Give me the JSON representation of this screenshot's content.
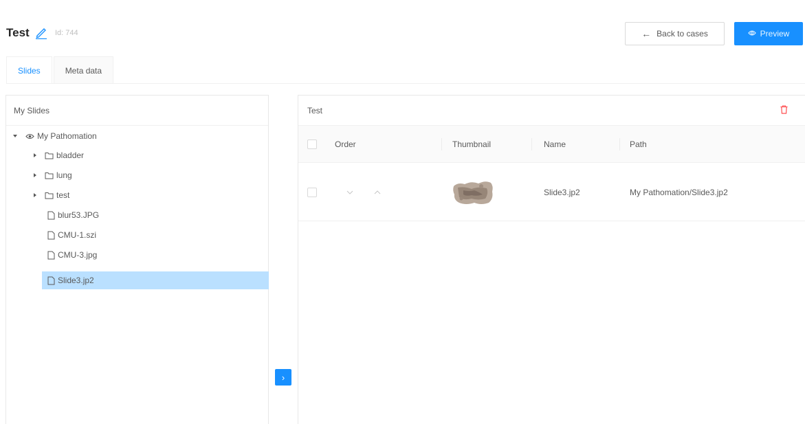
{
  "header": {
    "title": "Test",
    "id_label": "Id: 744",
    "back_button": "Back to cases",
    "preview_button": "Preview"
  },
  "tabs": [
    {
      "label": "Slides",
      "active": true
    },
    {
      "label": "Meta data",
      "active": false
    }
  ],
  "left_panel": {
    "title": "My Slides",
    "tree": [
      {
        "label": "My Pathomation",
        "type": "root",
        "expanded": true
      },
      {
        "label": "bladder",
        "type": "folder",
        "expanded": false
      },
      {
        "label": "lung",
        "type": "folder",
        "expanded": false
      },
      {
        "label": "test",
        "type": "folder",
        "expanded": false
      },
      {
        "label": "blur53.JPG",
        "type": "file"
      },
      {
        "label": "CMU-1.szi",
        "type": "file"
      },
      {
        "label": "CMU-3.jpg",
        "type": "file"
      },
      {
        "label": "Slide3.jp2",
        "type": "file",
        "selected": true
      }
    ]
  },
  "transfer_button": "›",
  "right_panel": {
    "title": "Test",
    "columns": {
      "order": "Order",
      "thumbnail": "Thumbnail",
      "name": "Name",
      "path": "Path"
    },
    "rows": [
      {
        "name": "Slide3.jp2",
        "path": "My Pathomation/Slide3.jp2"
      }
    ]
  },
  "icons": {
    "edit": "pencil-icon",
    "back": "arrow-left-icon",
    "preview": "eye-icon",
    "delete": "trash-icon",
    "root": "eye-icon",
    "folder": "folder-icon",
    "file": "file-icon",
    "move_down": "chevron-down-icon",
    "move_up": "chevron-up-icon"
  },
  "colors": {
    "primary": "#1890ff",
    "selected_row": "#bae0ff",
    "danger": "#ff4d4f"
  }
}
